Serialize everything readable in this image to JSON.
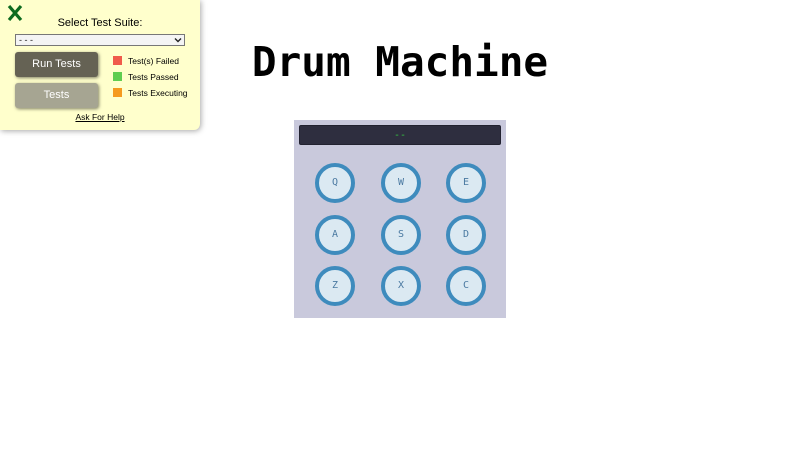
{
  "test_panel": {
    "suite_label": "Select Test Suite:",
    "suite_selected": "- - -",
    "run_button_label": "Run Tests",
    "tests_button_label": "Tests",
    "legend": [
      {
        "label": "Test(s) Failed",
        "color": "#f05b4a"
      },
      {
        "label": "Tests Passed",
        "color": "#5fcd50"
      },
      {
        "label": "Tests Executing",
        "color": "#f59a1e"
      }
    ],
    "help_link": "Ask For Help",
    "close_icon": "close-x-icon",
    "close_color": "#0e6b1f"
  },
  "main": {
    "title": "Drum Machine",
    "display_text": "--",
    "pads": [
      {
        "key": "Q"
      },
      {
        "key": "W"
      },
      {
        "key": "E"
      },
      {
        "key": "A"
      },
      {
        "key": "S"
      },
      {
        "key": "D"
      },
      {
        "key": "Z"
      },
      {
        "key": "X"
      },
      {
        "key": "C"
      }
    ]
  }
}
